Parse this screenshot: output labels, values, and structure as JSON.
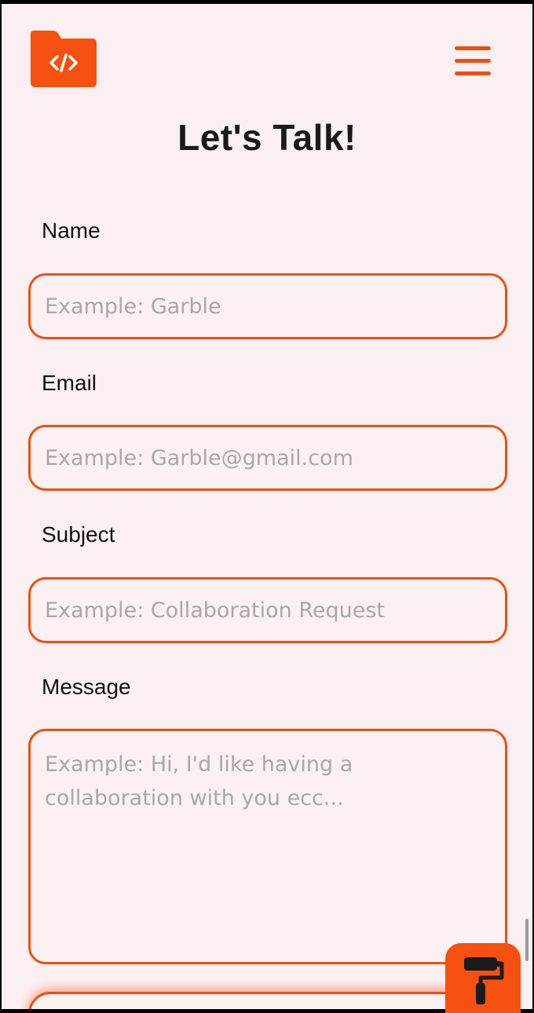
{
  "header": {
    "logo_icon": "folder-code-icon",
    "menu_icon": "hamburger-menu-icon"
  },
  "page": {
    "title": "Let's Talk!"
  },
  "form": {
    "name": {
      "label": "Name",
      "placeholder": "Example: Garble"
    },
    "email": {
      "label": "Email",
      "placeholder": "Example: Garble@gmail.com"
    },
    "subject": {
      "label": "Subject",
      "placeholder": "Example: Collaboration Request"
    },
    "message": {
      "label": "Message",
      "placeholder": "Example: Hi, I'd like having a collaboration with you ecc..."
    }
  },
  "fab": {
    "icon": "paint-roller-icon"
  },
  "colors": {
    "accent": "#ee4f10",
    "background": "#fbf0f1",
    "placeholder": "#a8a8a8",
    "text": "#1a1a1a"
  }
}
